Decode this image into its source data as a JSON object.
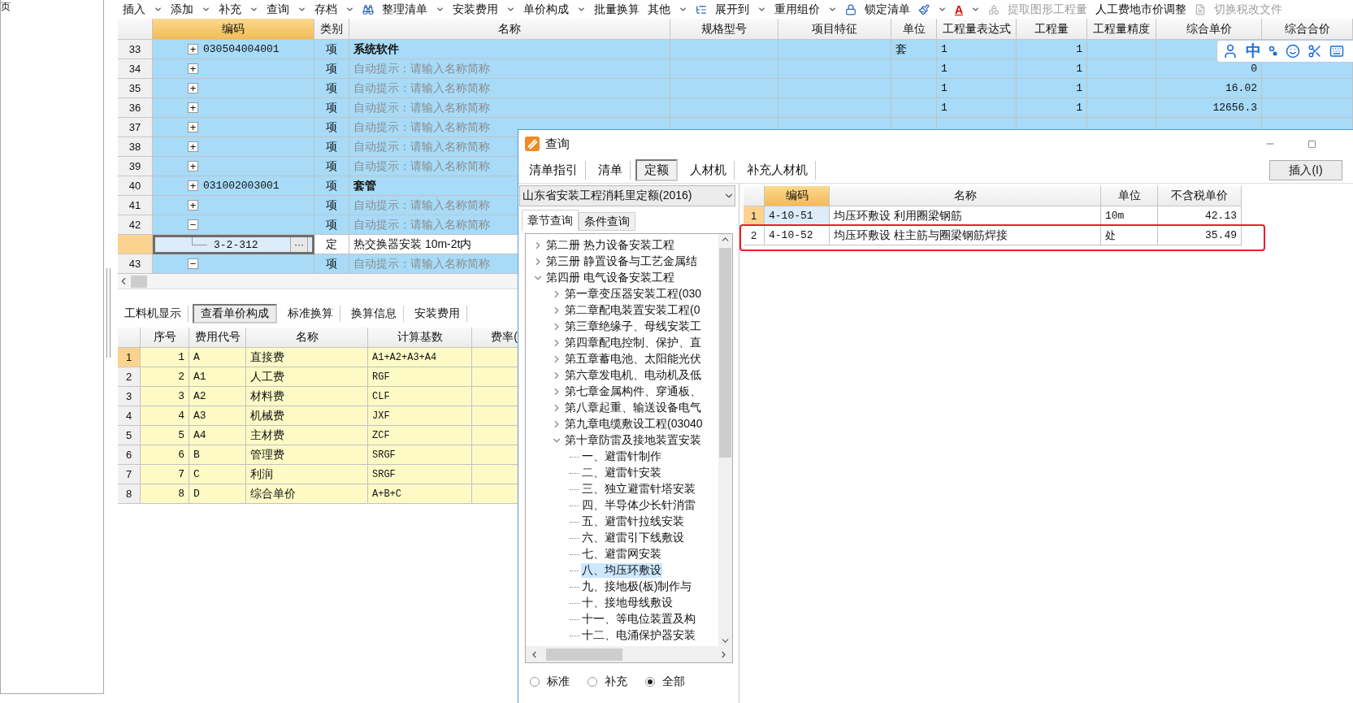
{
  "left_panel": {
    "title": "页"
  },
  "toolbar": [
    {
      "label": "插入",
      "kind": "text",
      "dropdown": true,
      "disabled": false
    },
    {
      "label": "添加",
      "kind": "text",
      "dropdown": true,
      "disabled": false
    },
    {
      "label": "补充",
      "kind": "text",
      "dropdown": true,
      "disabled": false
    },
    {
      "label": "查询",
      "kind": "text",
      "dropdown": true,
      "disabled": false
    },
    {
      "label": "存档",
      "kind": "text",
      "dropdown": true,
      "disabled": false
    },
    {
      "kind": "icon",
      "dropdown": false,
      "disabled": false
    },
    {
      "label": "整理清单",
      "kind": "text",
      "dropdown": true,
      "disabled": false
    },
    {
      "label": "安装费用",
      "kind": "text",
      "dropdown": true,
      "disabled": false
    },
    {
      "label": "单价构成",
      "kind": "text",
      "dropdown": true,
      "disabled": false
    },
    {
      "label": "批量换算",
      "kind": "text",
      "dropdown": false,
      "disabled": false
    },
    {
      "label": "其他",
      "kind": "text",
      "dropdown": true,
      "disabled": false
    },
    {
      "label": "展开到",
      "kind": "icon_text",
      "dropdown": true,
      "disabled": false
    },
    {
      "label": "重用组价",
      "kind": "text",
      "dropdown": true,
      "disabled": false
    },
    {
      "label": "锁定清单",
      "kind": "icon_text",
      "dropdown": false,
      "disabled": false
    },
    {
      "kind": "icon",
      "dropdown": true,
      "disabled": false
    },
    {
      "label": "A",
      "kind": "font_color",
      "dropdown": true,
      "disabled": false
    },
    {
      "label": "提取图形工程量",
      "kind": "icon_text",
      "dropdown": false,
      "disabled": true
    },
    {
      "label": "人工费地市价调整",
      "kind": "text",
      "dropdown": false,
      "disabled": false
    },
    {
      "label": "切换税改文件",
      "kind": "icon_text",
      "dropdown": false,
      "disabled": true
    }
  ],
  "top_table": {
    "columns": [
      {
        "label": "编码",
        "selected": true
      },
      {
        "label": "类别",
        "selected": false
      },
      {
        "label": "名称",
        "selected": false
      },
      {
        "label": "规格型号",
        "selected": false
      },
      {
        "label": "项目特征",
        "selected": false
      },
      {
        "label": "单位",
        "selected": false
      },
      {
        "label": "工程量表达式",
        "selected": false
      },
      {
        "label": "工程量",
        "selected": false
      },
      {
        "label": "工程量精度",
        "selected": false
      },
      {
        "label": "综合单价",
        "selected": false
      },
      {
        "label": "综合合价",
        "selected": false
      }
    ],
    "rows": [
      {
        "num": "33",
        "kind": "bill",
        "toggle": "+",
        "code": "030504004001",
        "type": "项",
        "name": "系统软件",
        "unit": "套",
        "expr": "1",
        "qty": "1",
        "selected": false
      },
      {
        "num": "34",
        "kind": "bill",
        "toggle": "+",
        "type": "项",
        "placeholder": "自动提示：请输入名称简称",
        "expr": "1",
        "qty": "1",
        "price": "0",
        "selected": false
      },
      {
        "num": "35",
        "kind": "bill",
        "toggle": "+",
        "type": "项",
        "placeholder": "自动提示：请输入名称简称",
        "expr": "1",
        "qty": "1",
        "price": "16.02",
        "selected": false
      },
      {
        "num": "36",
        "kind": "bill",
        "toggle": "+",
        "type": "项",
        "placeholder": "自动提示：请输入名称简称",
        "expr": "1",
        "qty": "1",
        "price": "12656.3",
        "selected": false
      },
      {
        "num": "37",
        "kind": "bill",
        "toggle": "+",
        "type": "项",
        "placeholder": "自动提示：请输入名称简称",
        "selected": false
      },
      {
        "num": "38",
        "kind": "bill",
        "toggle": "+",
        "type": "项",
        "placeholder": "自动提示：请输入名称简称",
        "selected": false
      },
      {
        "num": "39",
        "kind": "bill",
        "toggle": "+",
        "type": "项",
        "placeholder": "自动提示：请输入名称简称",
        "selected": false
      },
      {
        "num": "40",
        "kind": "bill",
        "toggle": "+",
        "code": "031002003001",
        "type": "项",
        "name": "套管",
        "selected": false
      },
      {
        "num": "41",
        "kind": "bill",
        "toggle": "+",
        "type": "项",
        "placeholder": "自动提示：请输入名称简称",
        "selected": false
      },
      {
        "num": "42",
        "kind": "bill",
        "toggle": "−",
        "type": "项",
        "placeholder": "自动提示：请输入名称简称",
        "selected": false
      },
      {
        "kind": "quota",
        "code": "3-2-312",
        "action": "···",
        "type": "定",
        "name": "热交换器安装 10m-2t内",
        "selected": true
      },
      {
        "num": "43",
        "kind": "bill",
        "toggle": "−",
        "type": "项",
        "placeholder": "自动提示：请输入名称简称",
        "selected": false
      }
    ]
  },
  "ime_bar": {
    "mode": "中"
  },
  "bottom_tabs": [
    {
      "label": "工料机显示",
      "selected": false
    },
    {
      "label": "查看单价构成",
      "selected": true
    },
    {
      "label": "标准换算",
      "selected": false
    },
    {
      "label": "换算信息",
      "selected": false
    },
    {
      "label": "安装费用",
      "selected": false
    }
  ],
  "fee_table": {
    "columns": [
      "序号",
      "费用代号",
      "名称",
      "计算基数",
      "费率("
    ],
    "rows": [
      {
        "num": "1",
        "seq": "1",
        "code": "A",
        "name": "直接费",
        "base": "A1+A2+A3+A4",
        "selected": true
      },
      {
        "num": "2",
        "seq": "2",
        "code": "A1",
        "name": "人工费",
        "base": "RGF",
        "selected": false
      },
      {
        "num": "3",
        "seq": "3",
        "code": "A2",
        "name": "材料费",
        "base": "CLF",
        "selected": false
      },
      {
        "num": "4",
        "seq": "4",
        "code": "A3",
        "name": "机械费",
        "base": "JXF",
        "selected": false
      },
      {
        "num": "5",
        "seq": "5",
        "code": "A4",
        "name": "主材费",
        "base": "ZCF",
        "selected": false
      },
      {
        "num": "6",
        "seq": "6",
        "code": "B",
        "name": "管理费",
        "base": "SRGF",
        "selected": false
      },
      {
        "num": "7",
        "seq": "7",
        "code": "C",
        "name": "利润",
        "base": "SRGF",
        "selected": false
      },
      {
        "num": "8",
        "seq": "8",
        "code": "D",
        "name": "综合单价",
        "base": "A+B+C",
        "selected": false
      }
    ]
  },
  "dialog": {
    "title": "查询",
    "tabs": [
      {
        "label": "清单指引",
        "selected": false
      },
      {
        "label": "清单",
        "selected": false
      },
      {
        "label": "定额",
        "selected": true
      },
      {
        "label": "人材机",
        "selected": false
      },
      {
        "label": "补充人材机",
        "selected": false
      }
    ],
    "insert_button": "插入(I)",
    "library": "山东省安装工程消耗里定额(2016)",
    "subtabs": [
      {
        "label": "章节查询",
        "selected": true
      },
      {
        "label": "条件查询",
        "selected": false
      }
    ],
    "tree": [
      {
        "label": "第二册 热力设备安装工程",
        "expanded": false,
        "selected": false
      },
      {
        "label": "第三册 静置设备与工艺金属结",
        "expanded": false,
        "selected": false
      },
      {
        "label": "第四册 电气设备安装工程",
        "expanded": true,
        "selected": false,
        "children": [
          {
            "label": "第一章变压器安装工程(030",
            "expanded": false,
            "selected": false
          },
          {
            "label": "第二章配电装置安装工程(0",
            "expanded": false,
            "selected": false
          },
          {
            "label": "第三章绝缘子、母线安装工",
            "expanded": false,
            "selected": false
          },
          {
            "label": "第四章配电控制、保护、直",
            "expanded": false,
            "selected": false
          },
          {
            "label": "第五章蓄电池、太阳能光伏",
            "expanded": false,
            "selected": false
          },
          {
            "label": "第六章发电机、电动机及低",
            "expanded": false,
            "selected": false
          },
          {
            "label": "第七章金属构件、穿通板、",
            "expanded": false,
            "selected": false
          },
          {
            "label": "第八章起重、输送设备电气",
            "expanded": false,
            "selected": false
          },
          {
            "label": "第九章电缆敷设工程(03040",
            "expanded": false,
            "selected": false
          },
          {
            "label": "第十章防雷及接地装置安装",
            "expanded": true,
            "selected": false,
            "children": [
              {
                "label": "一、避雷针制作",
                "selected": false
              },
              {
                "label": "二、避雷针安装",
                "selected": false
              },
              {
                "label": "三、独立避雷针塔安装",
                "selected": false
              },
              {
                "label": "四、半导体少长针消雷",
                "selected": false
              },
              {
                "label": "五、避雷针拉线安装",
                "selected": false
              },
              {
                "label": "六、避雷引下线敷设",
                "selected": false
              },
              {
                "label": "七、避雷网安装",
                "selected": false
              },
              {
                "label": "八、均压环敷设",
                "selected": true
              },
              {
                "label": "九、接地极(板)制作与",
                "selected": false
              },
              {
                "label": "十、接地母线敷设",
                "selected": false
              },
              {
                "label": "十一、等电位装置及构",
                "selected": false
              },
              {
                "label": "十二、电涌保护器安装",
                "selected": false
              }
            ]
          }
        ]
      }
    ],
    "radios": [
      {
        "label": "标准",
        "selected": false
      },
      {
        "label": "补充",
        "selected": false
      },
      {
        "label": "全部",
        "selected": true
      }
    ],
    "results": {
      "columns": [
        {
          "label": "编码",
          "selected": true
        },
        {
          "label": "名称",
          "selected": false
        },
        {
          "label": "单位",
          "selected": false
        },
        {
          "label": "不含税单价",
          "selected": false
        }
      ],
      "rows": [
        {
          "num": "1",
          "code": "4-10-51",
          "name": "均压环敷设 利用圈梁钢筋",
          "unit": "10m",
          "price": "42.13",
          "selected": true,
          "annotated": false
        },
        {
          "num": "2",
          "code": "4-10-52",
          "name": "均压环敷设 柱主筋与圈梁钢筋焊接",
          "unit": "处",
          "price": "35.49",
          "selected": false,
          "annotated": true
        }
      ]
    }
  }
}
